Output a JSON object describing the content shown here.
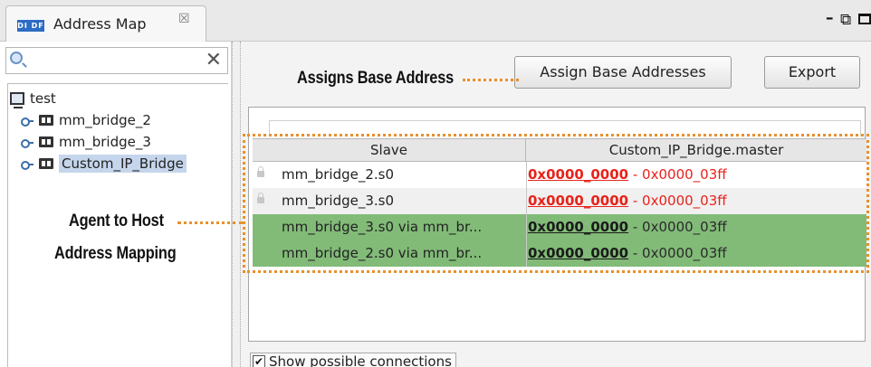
{
  "tab": {
    "icon_text": "DI DF",
    "title": "Address Map",
    "close_symbol": "☒"
  },
  "window_controls": {
    "minimize": "–",
    "detach": "⧉"
  },
  "tree": {
    "root": "test",
    "children": [
      "mm_bridge_2",
      "mm_bridge_3",
      "Custom_IP_Bridge"
    ],
    "selected": "Custom_IP_Bridge"
  },
  "buttons": {
    "assign": "Assign Base Addresses",
    "export": "Export"
  },
  "table": {
    "headers": [
      "Slave",
      "Custom_IP_Bridge.master"
    ],
    "rows": [
      {
        "slave": "mm_bridge_2.s0",
        "base": "0x0000_0000",
        "rest": " - 0x0000_03ff",
        "style": "red"
      },
      {
        "slave": "mm_bridge_3.s0",
        "base": "0x0000_0000",
        "rest": " - 0x0000_03ff",
        "style": "red"
      },
      {
        "slave": "mm_bridge_3.s0 via mm_br...",
        "base": "0x0000_0000",
        "rest": " - 0x0000_03ff",
        "style": "green"
      },
      {
        "slave": "mm_bridge_2.s0 via mm_br...",
        "base": "0x0000_0000",
        "rest": " - 0x0000_03ff",
        "style": "green"
      }
    ]
  },
  "checkbox": {
    "label": "Show possible connections",
    "checked": true
  },
  "annotations": {
    "assign": "Assigns Base Address",
    "agent_line1": "Agent to Host",
    "agent_line2": "Address Mapping",
    "highlight_color": "#e8902e"
  },
  "colors": {
    "error_red": "#e8221a",
    "connected_green": "#82bb78",
    "selection": "#c5d6ec"
  }
}
